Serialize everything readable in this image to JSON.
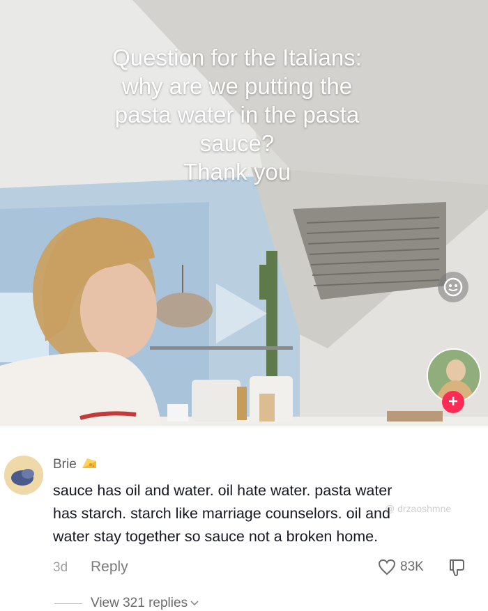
{
  "video": {
    "caption_lines": [
      "Question for the Italians:",
      "why are we putting the",
      "pasta water in the pasta",
      "sauce?",
      "Thank you"
    ],
    "follow_symbol": "+"
  },
  "comment": {
    "username": "Brie",
    "username_emoji": "cheese-icon",
    "text_lines": [
      "sauce has oil and water. oil hate water. pasta water",
      "has starch. starch like marriage counselors. oil and",
      "water stay together so sauce not a broken home."
    ],
    "time": "3d",
    "reply_label": "Reply",
    "like_count": "83K",
    "watermark": "@ drzaoshmne",
    "view_replies_label": "View 321 replies"
  },
  "colors": {
    "accent": "#fe2c55",
    "text_primary": "#161823",
    "text_secondary": "#7a7a7a"
  }
}
